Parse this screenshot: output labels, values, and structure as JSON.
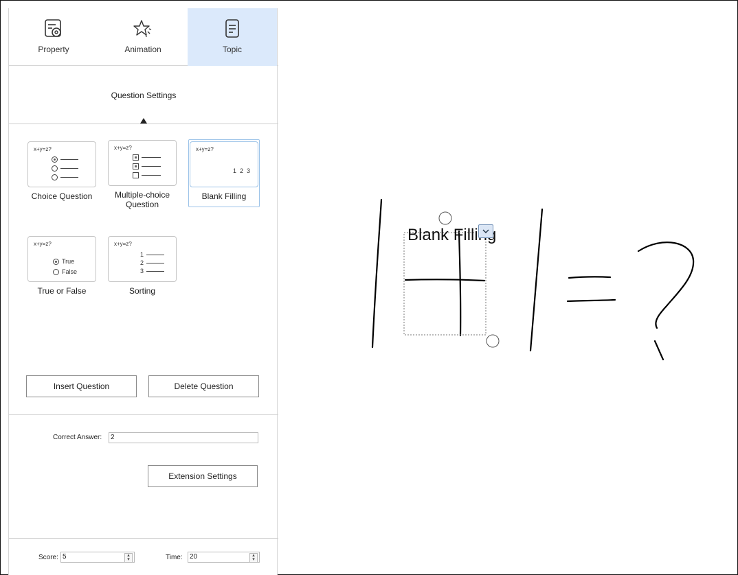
{
  "tabs": [
    {
      "label": "Property",
      "icon": "property-settings-icon"
    },
    {
      "label": "Animation",
      "icon": "animation-star-icon"
    },
    {
      "label": "Topic",
      "icon": "topic-document-icon",
      "active": true
    }
  ],
  "question_settings": {
    "title": "Question Settings",
    "types": [
      {
        "label": "Choice Question",
        "preview_eq": "x+y=z?"
      },
      {
        "label": "Multiple-choice Question",
        "preview_eq": "x+y=z?"
      },
      {
        "label": "Blank Filling",
        "preview_eq": "x+y=z?",
        "preview_values": "1  2  3",
        "selected": true
      },
      {
        "label": "True or False",
        "preview_eq": "x+y=z?",
        "true_label": "True",
        "false_label": "False"
      },
      {
        "label": "Sorting",
        "preview_eq": "x+y=z?",
        "items": [
          "1",
          "2",
          "3"
        ]
      }
    ]
  },
  "actions": {
    "insert": "Insert Question",
    "delete": "Delete Question",
    "extension": "Extension Settings"
  },
  "answer": {
    "label": "Correct Answer:",
    "value": "2"
  },
  "footer": {
    "score_label": "Score:",
    "score_value": "5",
    "time_label": "Time:",
    "time_value": "20"
  },
  "canvas": {
    "blank_label": "Blank Filling"
  },
  "colors": {
    "active_tab": "#dbe9fb",
    "selected_border": "#9cc3e8"
  }
}
